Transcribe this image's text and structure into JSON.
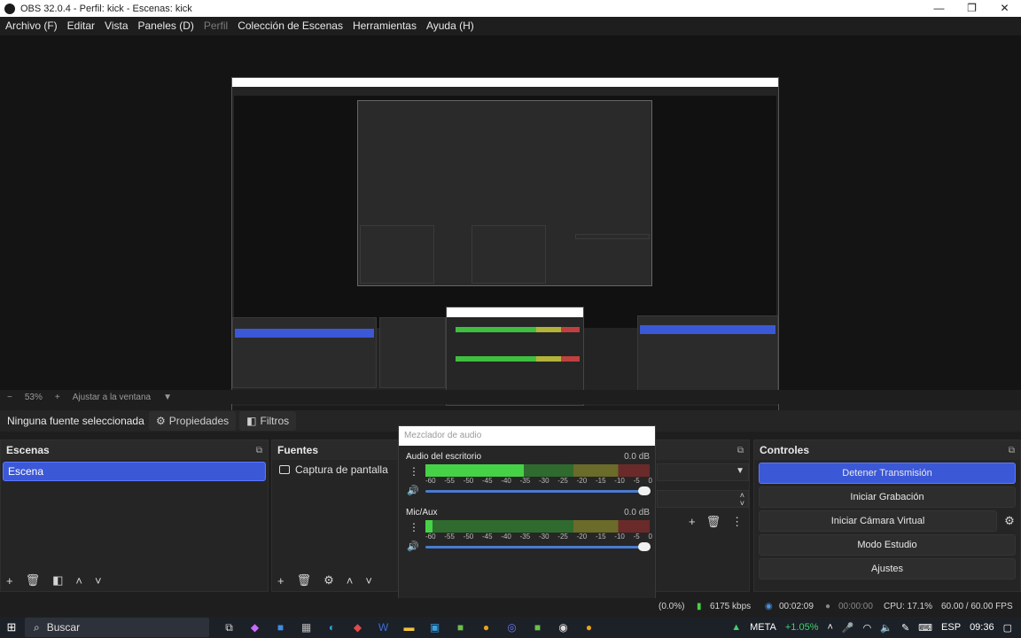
{
  "window": {
    "title": "OBS 32.0.4 - Perfil: kick - Escenas: kick",
    "controls": [
      "—",
      "❐",
      "✕"
    ]
  },
  "menu": [
    {
      "label": "Archivo (F)"
    },
    {
      "label": "Editar"
    },
    {
      "label": "Vista"
    },
    {
      "label": "Paneles (D)"
    },
    {
      "label": "Perfil"
    },
    {
      "label": "Colección de Escenas"
    },
    {
      "label": "Herramientas"
    },
    {
      "label": "Ayuda (H)"
    }
  ],
  "zoom": {
    "minus": "−",
    "value": "53%",
    "plus": "+",
    "fit": "Ajustar a la ventana",
    "arrow": "▼"
  },
  "source_bar": {
    "no_source": "Ninguna fuente seleccionada",
    "properties": "Propiedades",
    "filters": "Filtros"
  },
  "scenes": {
    "title": "Escenas",
    "items": [
      "Escena"
    ]
  },
  "sources": {
    "title": "Fuentes",
    "items": [
      "Captura de pantalla"
    ]
  },
  "mixer": {
    "title": "Mezclador de audio",
    "channels": [
      {
        "name": "Audio del escritorio",
        "db": "0.0 dB",
        "level": 0.44,
        "level2": 0.44
      },
      {
        "name": "Mic/Aux",
        "db": "0.0 dB",
        "level": 0.03,
        "level2": 0.03
      }
    ],
    "ticks": [
      "-60",
      "-55",
      "-50",
      "-45",
      "-40",
      "-35",
      "-30",
      "-25",
      "-20",
      "-15",
      "-10",
      "-5",
      "0"
    ]
  },
  "controls": {
    "title": "Controles",
    "buttons": [
      "Detener Transmisión",
      "Iniciar Grabación",
      "Iniciar Cámara Virtual",
      "Modo Estudio",
      "Ajustes"
    ]
  },
  "status": {
    "dropped": "(0.0%)",
    "bitrate": "6175 kbps",
    "stream_time": "00:02:09",
    "rec_time": "00:00:00",
    "cpu": "CPU: 17.1%",
    "fps": "60.00 / 60.00 FPS"
  },
  "taskbar": {
    "search_placeholder": "Buscar",
    "ticker": "META",
    "ticker_change": "+1.05%",
    "lang": "ESP",
    "time": "09:36"
  },
  "colors": {
    "accent": "#3b58d7",
    "meter_green": "#46d246",
    "ticker_green": "#3fd26b"
  }
}
